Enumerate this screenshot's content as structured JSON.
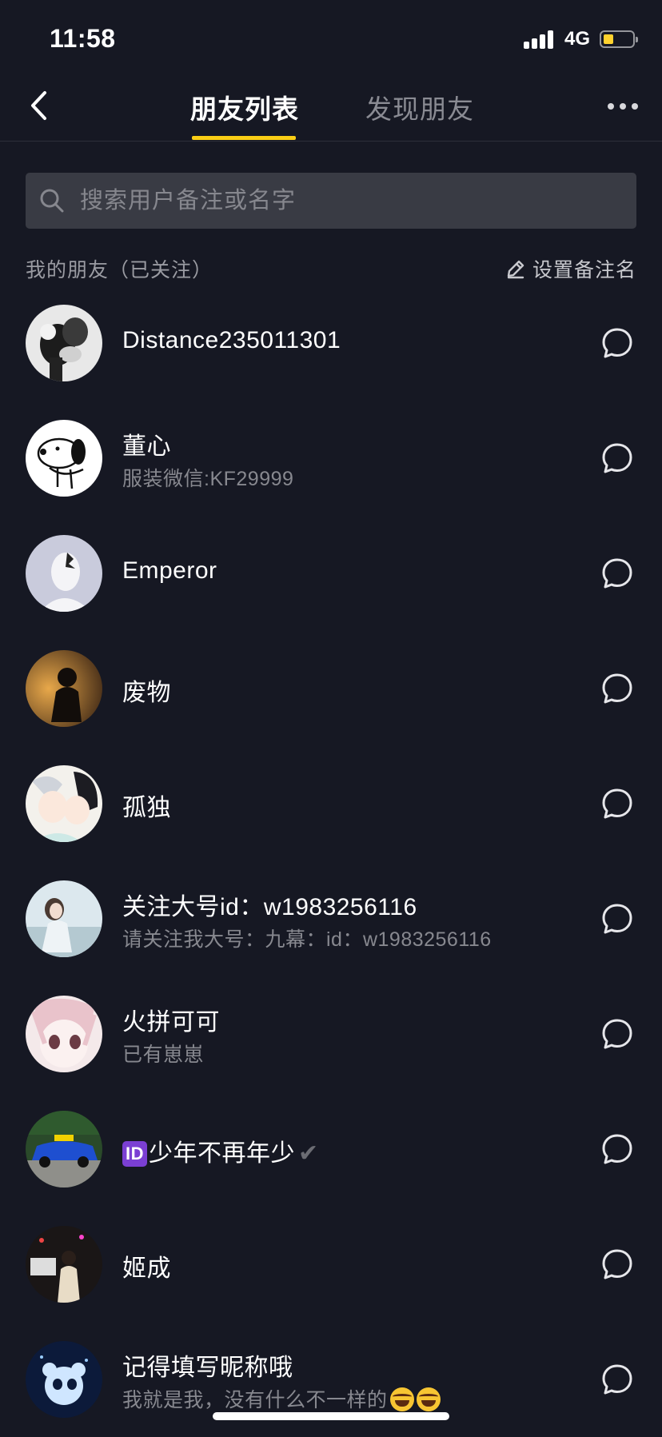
{
  "status_bar": {
    "time": "11:58",
    "network": "4G",
    "battery_level": 0.35,
    "battery_color": "#ffd22e"
  },
  "nav": {
    "tabs": [
      {
        "label": "朋友列表",
        "active": true
      },
      {
        "label": "发现朋友",
        "active": false
      }
    ],
    "back_icon": "chevron-left-icon",
    "more_icon": "more-dots-icon",
    "accent_color": "#face15"
  },
  "search": {
    "placeholder": "搜索用户备注或名字",
    "value": ""
  },
  "section": {
    "title": "我的朋友（已关注）",
    "action_label": "设置备注名"
  },
  "friends": [
    {
      "name": "Distance235011301",
      "subtitle": ""
    },
    {
      "name": "董心",
      "subtitle": "服装微信:KF29999"
    },
    {
      "name": "Emperor",
      "subtitle": ""
    },
    {
      "name": "废物",
      "subtitle": ""
    },
    {
      "name": "孤独",
      "subtitle": ""
    },
    {
      "name": "关注大号id：w1983256116",
      "subtitle": "请关注我大号：九幕：id：w1983256116"
    },
    {
      "name": "火拼可可",
      "subtitle": "已有崽崽"
    },
    {
      "name_badge": "ID",
      "name": "少年不再年少",
      "name_suffix": "✔",
      "subtitle": ""
    },
    {
      "name": "姬成",
      "subtitle": ""
    },
    {
      "name": "记得填写昵称哦",
      "subtitle": "我就是我，没有什么不一样的"
    }
  ]
}
